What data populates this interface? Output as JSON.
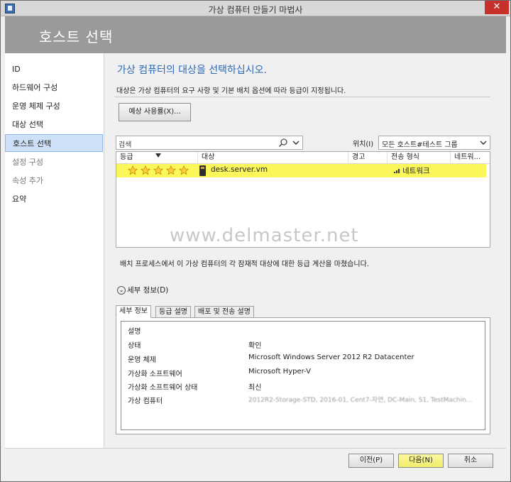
{
  "window": {
    "title": "가상 컴퓨터 만들기 마법사",
    "close_label": "✕"
  },
  "header": {
    "title": "호스트 선택"
  },
  "sidebar": {
    "items": [
      {
        "label": "ID",
        "state": "normal"
      },
      {
        "label": "하드웨어 구성",
        "state": "normal"
      },
      {
        "label": "운영 체제 구성",
        "state": "normal"
      },
      {
        "label": "대상 선택",
        "state": "normal"
      },
      {
        "label": "호스트 선택",
        "state": "active"
      },
      {
        "label": "설정 구성",
        "state": "dim"
      },
      {
        "label": "속성 추가",
        "state": "dim"
      },
      {
        "label": "요약",
        "state": "normal"
      }
    ]
  },
  "main": {
    "title": "가상 컴퓨터의 대상을 선택하십시오.",
    "subtitle": "대상은 가상 컴퓨터의 요구 사항 및 기본 배치 옵션에 따라 등급이 지정됩니다.",
    "expected_usage_button": "예상 사용률(X)...",
    "search": {
      "placeholder": "검색"
    },
    "location": {
      "label": "위치(I)",
      "selected": "모든 호스트#테스트 그룹"
    },
    "grid": {
      "columns": [
        "등급",
        "대상",
        "경고",
        "전송 형식",
        "네트워..."
      ],
      "rows": [
        {
          "rating": 5,
          "target": "desk.server.vm",
          "warning": "",
          "transfer": "네트워크"
        }
      ]
    },
    "watermark": "www.delmaster.net",
    "status": "배치 프로세스에서 이 가상 컴퓨터의 각 잠재적 대상에 대한 등급 계산을 마쳤습니다.",
    "details_toggle": "세부 정보(D)",
    "tabs": [
      "세부 정보",
      "등급 설명",
      "배포 및 전송 설명"
    ],
    "details": {
      "heading": "설명",
      "rows": [
        {
          "key": "상태",
          "value": "확인"
        },
        {
          "key": "운영 체제",
          "value": "Microsoft Windows Server 2012 R2 Datacenter"
        },
        {
          "key": "가상화 소프트웨어",
          "value": "Microsoft Hyper-V"
        },
        {
          "key": "가상화 소프트웨어 상태",
          "value": "최신"
        },
        {
          "key": "가상 컴퓨터",
          "value": "2012R2-Storage-STD, 2016-01, Cent7-자연, DC-Main, S1, TestMachin..."
        }
      ]
    }
  },
  "footer": {
    "prev": "이전(P)",
    "next": "다음(N)",
    "cancel": "취소"
  },
  "colors": {
    "accent": "#2a69b8",
    "highlight": "#fbf65a",
    "header_bg": "#9a9a9a",
    "active_nav": "#cde0f7"
  }
}
